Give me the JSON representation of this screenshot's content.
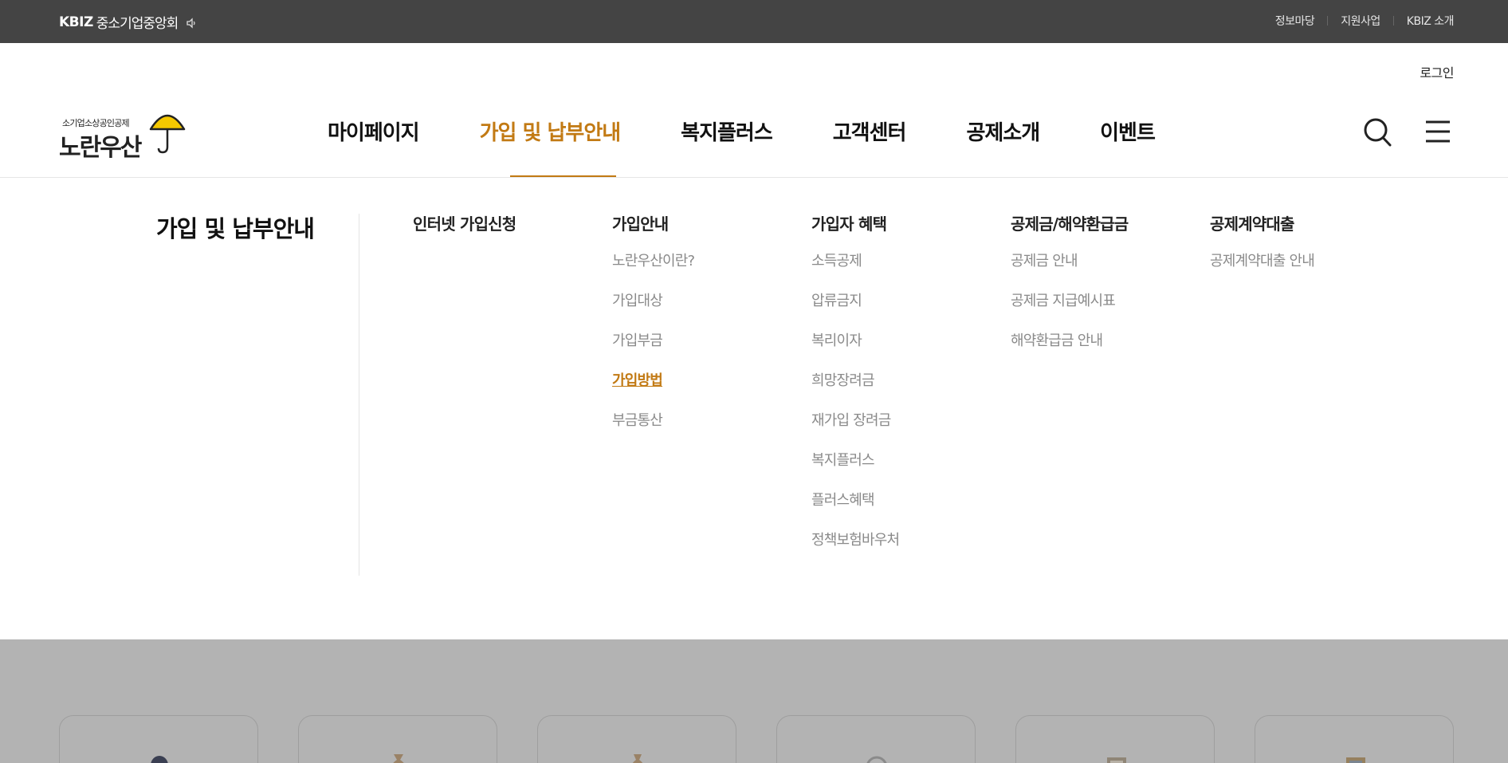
{
  "topbar": {
    "brand_mark": "KBIZ",
    "brand_name": "중소기업중앙회",
    "links": [
      "정보마당",
      "지원사업",
      "KBIZ 소개"
    ]
  },
  "header": {
    "login": "로그인",
    "logo_small": "소기업소상공인공제",
    "logo_big": "노란우산",
    "gnb": [
      {
        "label": "마이페이지",
        "active": false
      },
      {
        "label": "가입 및 납부안내",
        "active": true
      },
      {
        "label": "복지플러스",
        "active": false
      },
      {
        "label": "고객센터",
        "active": false
      },
      {
        "label": "공제소개",
        "active": false
      },
      {
        "label": "이벤트",
        "active": false
      }
    ]
  },
  "mega": {
    "title": "가입 및 납부안내",
    "columns": [
      {
        "head": "인터넷 가입신청",
        "items": []
      },
      {
        "head": "가입안내",
        "items": [
          "노란우산이란?",
          "가입대상",
          "가입부금",
          "가입방법",
          "부금통산"
        ],
        "active_index": 3
      },
      {
        "head": "가입자 혜택",
        "items": [
          "소득공제",
          "압류금지",
          "복리이자",
          "희망장려금",
          "재가입 장려금",
          "복지플러스",
          "플러스혜택",
          "정책보험바우처"
        ]
      },
      {
        "head": "공제금/해약환급금",
        "items": [
          "공제금 안내",
          "공제금 지급예시표",
          "해약환급금 안내"
        ]
      },
      {
        "head": "공제계약대출",
        "items": [
          "공제계약대출 안내"
        ]
      }
    ]
  },
  "colors": {
    "accent": "#c27a14",
    "topbar": "#444444",
    "dim": "#b3b3b3",
    "umbrella": "#f5c800"
  },
  "icons": {
    "speaker": "speaker-icon",
    "search": "search-icon",
    "menu": "hamburger-menu-icon",
    "umbrella": "umbrella-icon"
  }
}
